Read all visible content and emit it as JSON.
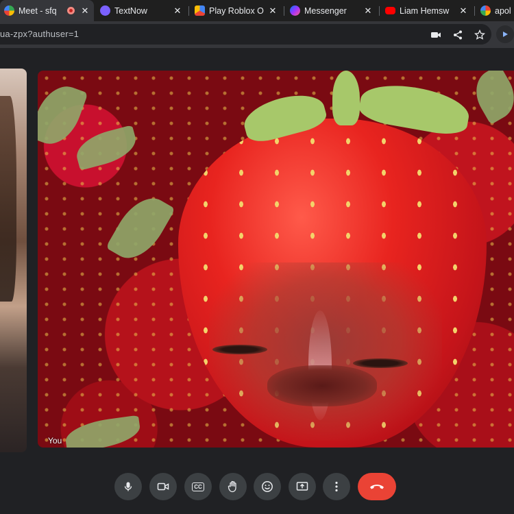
{
  "browser": {
    "tabs": [
      {
        "title": "Meet - sfq",
        "favicon": "google-meet-icon",
        "recording": true,
        "active": true
      },
      {
        "title": "TextNow",
        "favicon": "textnow-icon",
        "active": false
      },
      {
        "title": "Play Roblox O",
        "favicon": "roblox-icon",
        "active": false
      },
      {
        "title": "Messenger",
        "favicon": "messenger-icon",
        "active": false
      },
      {
        "title": "Liam Hemsw",
        "favicon": "youtube-icon",
        "active": false
      },
      {
        "title": "apol",
        "favicon": "google-icon",
        "active": false
      }
    ],
    "address": {
      "url": "ua-zpx?authuser=1"
    },
    "toolbar_icons": [
      "camera-icon",
      "share-icon",
      "star-icon",
      "extension-icon"
    ]
  },
  "meet": {
    "self_label": "You",
    "controls": [
      {
        "name": "mic-button",
        "icon": "microphone-icon"
      },
      {
        "name": "camera-button",
        "icon": "video-camera-icon"
      },
      {
        "name": "captions-button",
        "icon": "captions-icon",
        "glyph": "CC"
      },
      {
        "name": "raise-hand-button",
        "icon": "hand-icon"
      },
      {
        "name": "reactions-button",
        "icon": "emoji-icon"
      },
      {
        "name": "present-button",
        "icon": "present-screen-icon"
      },
      {
        "name": "more-options-button",
        "icon": "more-vert-icon"
      },
      {
        "name": "leave-call-button",
        "icon": "end-call-icon"
      }
    ],
    "colors": {
      "end_call": "#ea4335",
      "control_bg": "#3c4043",
      "page_bg": "#202124"
    }
  }
}
